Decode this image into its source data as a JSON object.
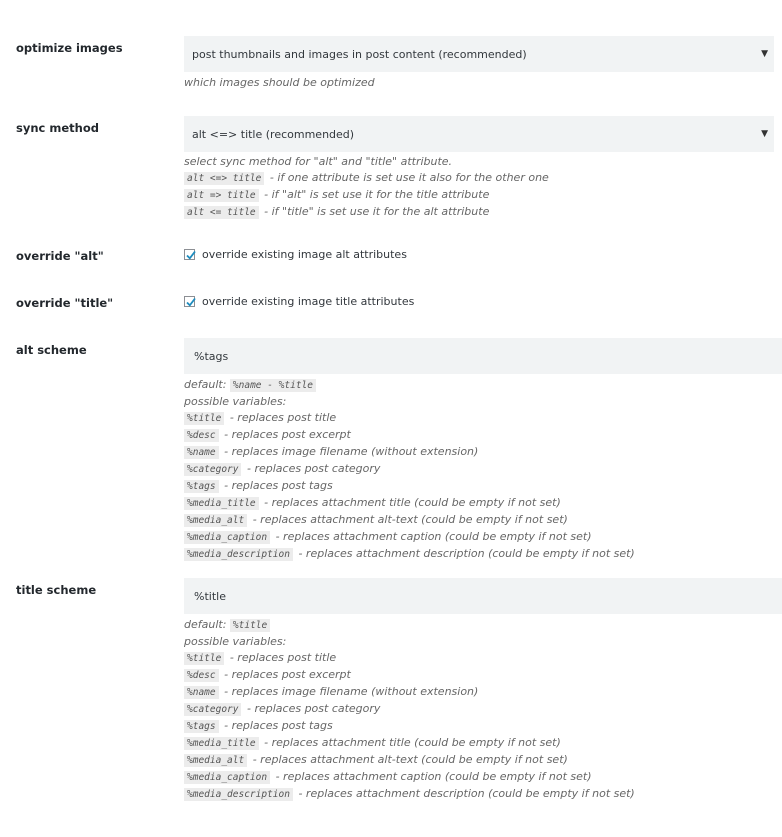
{
  "optimize_images": {
    "label": "optimize images",
    "selected": "post thumbnails and images in post content (recommended)",
    "description": "which images should be optimized"
  },
  "sync_method": {
    "label": "sync method",
    "selected": "alt <=> title (recommended)",
    "description": "select sync method for \"alt\" and \"title\" attribute.",
    "options_help": [
      {
        "code": "alt <=> title",
        "text": "- if one attribute is set use it also for the other one"
      },
      {
        "code": "alt => title",
        "text": "- if \"alt\" is set use it for the title attribute"
      },
      {
        "code": "alt <= title",
        "text": "- if \"title\" is set use it for the alt attribute"
      }
    ]
  },
  "override_alt": {
    "label": "override \"alt\"",
    "checkbox_label": "override existing image alt attributes",
    "checked": true
  },
  "override_title": {
    "label": "override \"title\"",
    "checkbox_label": "override existing image title attributes",
    "checked": true
  },
  "alt_scheme": {
    "label": "alt scheme",
    "value": "%tags",
    "default_prefix": "default:",
    "default_code": "%name - %title",
    "possible_variables": "possible variables:",
    "variables": [
      {
        "code": "%title",
        "text": "- replaces post title"
      },
      {
        "code": "%desc",
        "text": "- replaces post excerpt"
      },
      {
        "code": "%name",
        "text": "- replaces image filename (without extension)"
      },
      {
        "code": "%category",
        "text": "- replaces post category"
      },
      {
        "code": "%tags",
        "text": "- replaces post tags"
      },
      {
        "code": "%media_title",
        "text": "- replaces attachment title (could be empty if not set)"
      },
      {
        "code": "%media_alt",
        "text": "- replaces attachment alt-text (could be empty if not set)"
      },
      {
        "code": "%media_caption",
        "text": "- replaces attachment caption (could be empty if not set)"
      },
      {
        "code": "%media_description",
        "text": "- replaces attachment description (could be empty if not set)"
      }
    ]
  },
  "title_scheme": {
    "label": "title scheme",
    "value": "%title",
    "default_prefix": "default:",
    "default_code": "%title",
    "possible_variables": "possible variables:",
    "variables": [
      {
        "code": "%title",
        "text": "- replaces post title"
      },
      {
        "code": "%desc",
        "text": "- replaces post excerpt"
      },
      {
        "code": "%name",
        "text": "- replaces image filename (without extension)"
      },
      {
        "code": "%category",
        "text": "- replaces post category"
      },
      {
        "code": "%tags",
        "text": "- replaces post tags"
      },
      {
        "code": "%media_title",
        "text": "- replaces attachment title (could be empty if not set)"
      },
      {
        "code": "%media_alt",
        "text": "- replaces attachment alt-text (could be empty if not set)"
      },
      {
        "code": "%media_caption",
        "text": "- replaces attachment caption (could be empty if not set)"
      },
      {
        "code": "%media_description",
        "text": "- replaces attachment description (could be empty if not set)"
      }
    ]
  },
  "icons": {
    "dropdown": "▼"
  }
}
